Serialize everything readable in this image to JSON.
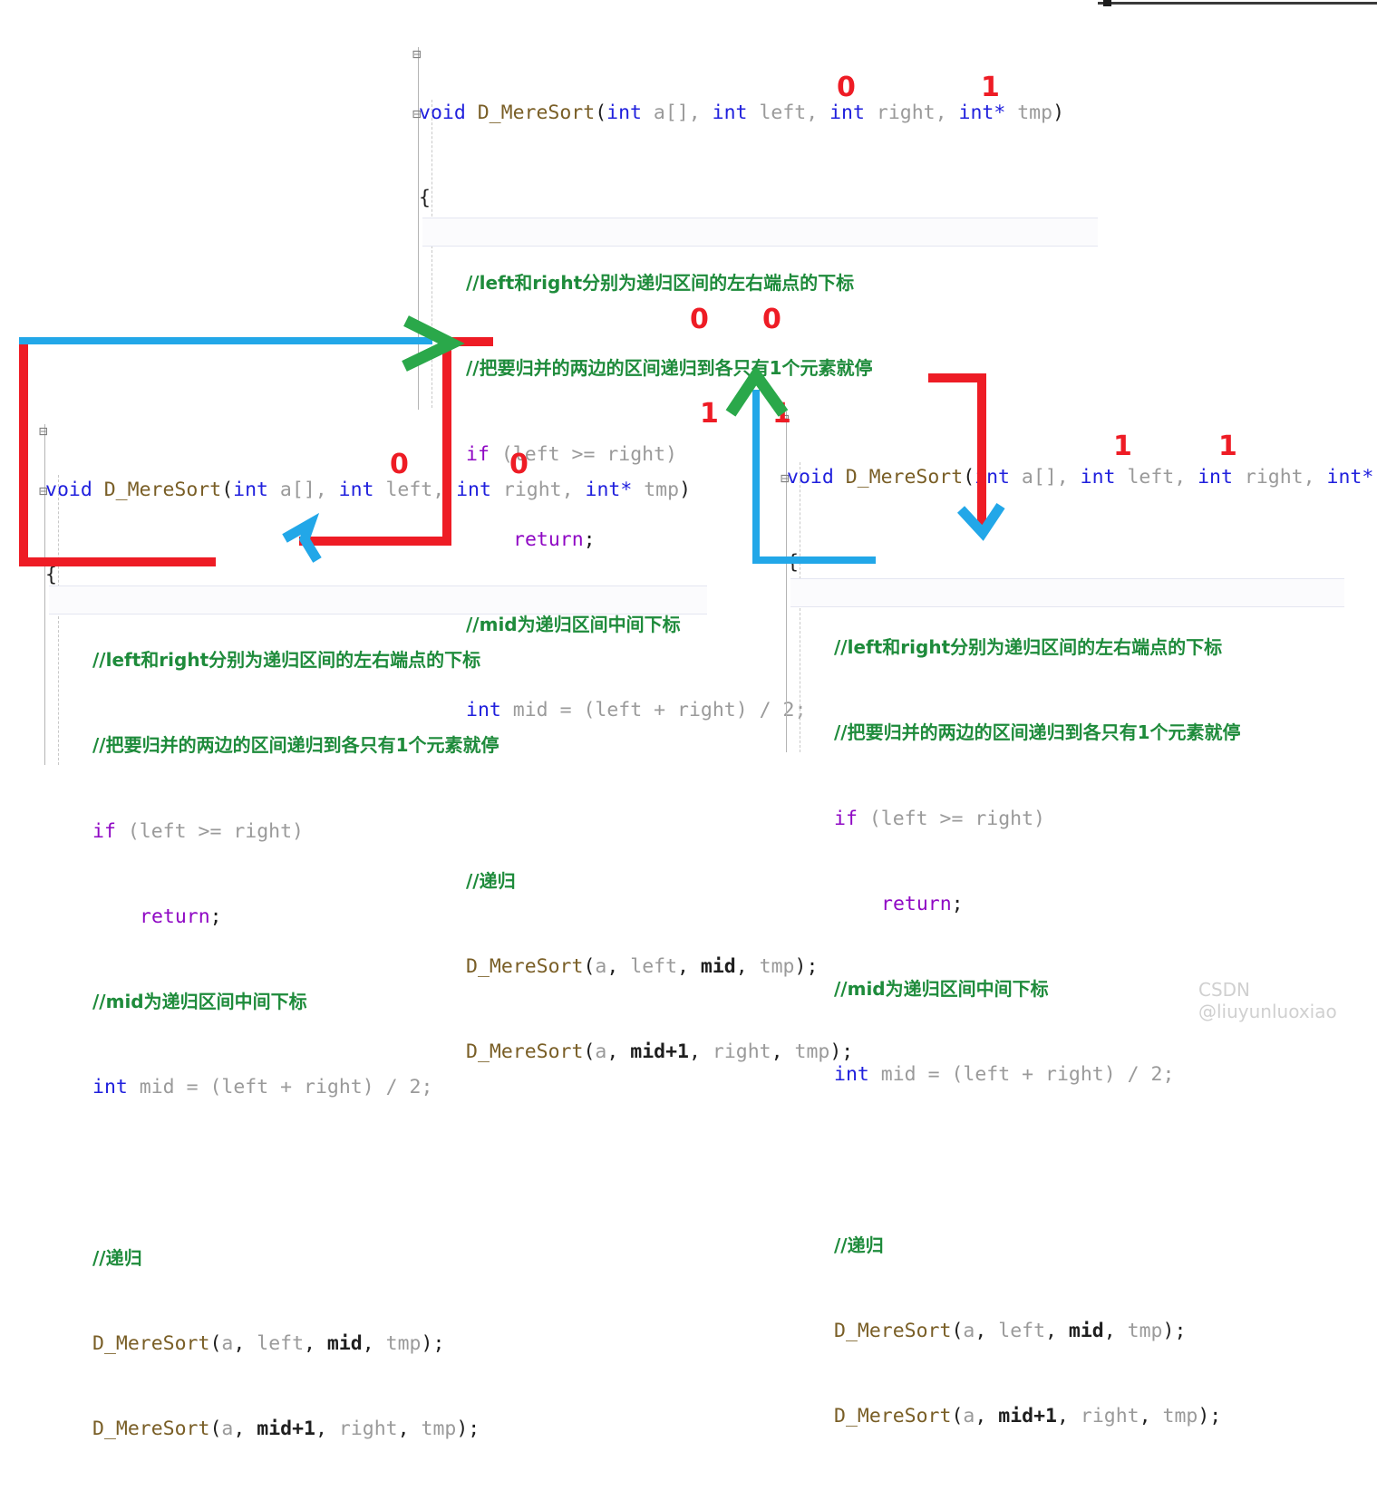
{
  "watermark": "CSDN @liuyunluoxiao",
  "code": {
    "signature": {
      "void": "void",
      "fname": "D_MereSort",
      "open": "(",
      "p1_type": "int",
      "p1_name": " a[], ",
      "p2_type": "int",
      "p2_name": " left, ",
      "p3_type": "int",
      "p3_name": " right, ",
      "p4_type": "int*",
      "p4_name": " tmp",
      "close": ")"
    },
    "brace_open": "{",
    "comment_1": "//left和right分别为递归区间的左右端点的下标",
    "comment_2": "//把要归并的两边的区间递归到各只有1个元素就停",
    "if_kw": "if",
    "if_cond": " (left >= right)",
    "return_kw": "return",
    "semi": ";",
    "comment_3": "//mid为递归区间中间下标",
    "mid_decl_type": "int",
    "mid_decl_rest": " mid = (left + right) / 2;",
    "comment_4": "//递归",
    "call_1": "D_MereSort(a, left, mid, tmp);",
    "call_2": "D_MereSort(a, mid+1, right, tmp);",
    "call_1_parts": {
      "fn": "D_MereSort",
      "open": "(",
      "a": "a",
      "sep1": ", ",
      "left": "left",
      "sep2": ", ",
      "mid": "mid",
      "sep3": ", ",
      "tmp": "tmp",
      "close": ");"
    },
    "call_2_parts": {
      "fn": "D_MereSort",
      "open": "(",
      "a": "a",
      "sep1": ", ",
      "mid1": "mid+1",
      "sep2": ", ",
      "right": "right",
      "sep3": ", ",
      "tmp": "tmp",
      "close": ");"
    }
  },
  "annotations": {
    "colors": {
      "red": "#ee1c25",
      "blue": "#22a7e8",
      "green": "#2aa84a",
      "comment_green": "#1e8b3b",
      "keyword_blue": "#2020dd",
      "keyword_purple": "#8f08c4",
      "function_brown": "#795e26"
    },
    "markers": {
      "top_left_param": "0",
      "top_right_param": "1",
      "top_call_mid_left": "0",
      "top_call_mid_right": "0",
      "left_block_left_param": "0",
      "left_block_right_param": "0",
      "mid_marker_left": "1",
      "mid_marker_right": "1",
      "right_block_left_param": "1",
      "right_block_right_param": "1"
    }
  }
}
